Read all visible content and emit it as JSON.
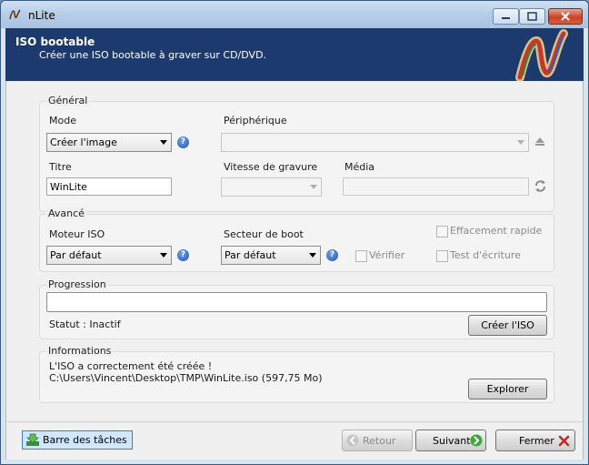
{
  "window": {
    "title": "nLite"
  },
  "banner": {
    "title": "ISO bootable",
    "subtitle": "Créer une ISO bootable à graver sur CD/DVD."
  },
  "general": {
    "legend": "Général",
    "mode_label": "Mode",
    "mode_value": "Créer l'image",
    "device_label": "Périphérique",
    "device_value": "",
    "title_label": "Titre",
    "title_value": "WinLite",
    "speed_label": "Vitesse de gravure",
    "speed_value": "",
    "media_label": "Média",
    "media_value": ""
  },
  "advanced": {
    "legend": "Avancé",
    "engine_label": "Moteur ISO",
    "engine_value": "Par défaut",
    "bootsector_label": "Secteur de boot",
    "bootsector_value": "Par défaut",
    "quick_erase_label": "Effacement rapide",
    "verify_label": "Vérifier",
    "write_test_label": "Test d'écriture"
  },
  "progress": {
    "legend": "Progression",
    "status_text": "Statut : Inactif",
    "create_button": "Créer l'ISO",
    "value": 0
  },
  "info": {
    "legend": "Informations",
    "line1": "L'ISO a correctement été créée !",
    "line2": "C:\\Users\\Vincent\\Desktop\\TMP\\WinLite.iso (597,75 Mo)",
    "explore_button": "Explorer"
  },
  "footer": {
    "taskbar_button": "Barre des tâches",
    "back_button": "Retour",
    "next_button": "Suivant",
    "close_button": "Fermer"
  },
  "colors": {
    "banner": "#1c3a6e",
    "title_bar": "#b5cde8",
    "close_red": "#c7422a",
    "help_blue": "#1f56b8"
  },
  "icons": [
    "nlite-logo-icon",
    "minimize-icon",
    "maximize-icon",
    "close-icon",
    "help-icon",
    "eject-icon",
    "refresh-icon",
    "taskbar-arrow-icon",
    "back-arrow-icon",
    "next-arrow-icon",
    "close-x-icon"
  ]
}
